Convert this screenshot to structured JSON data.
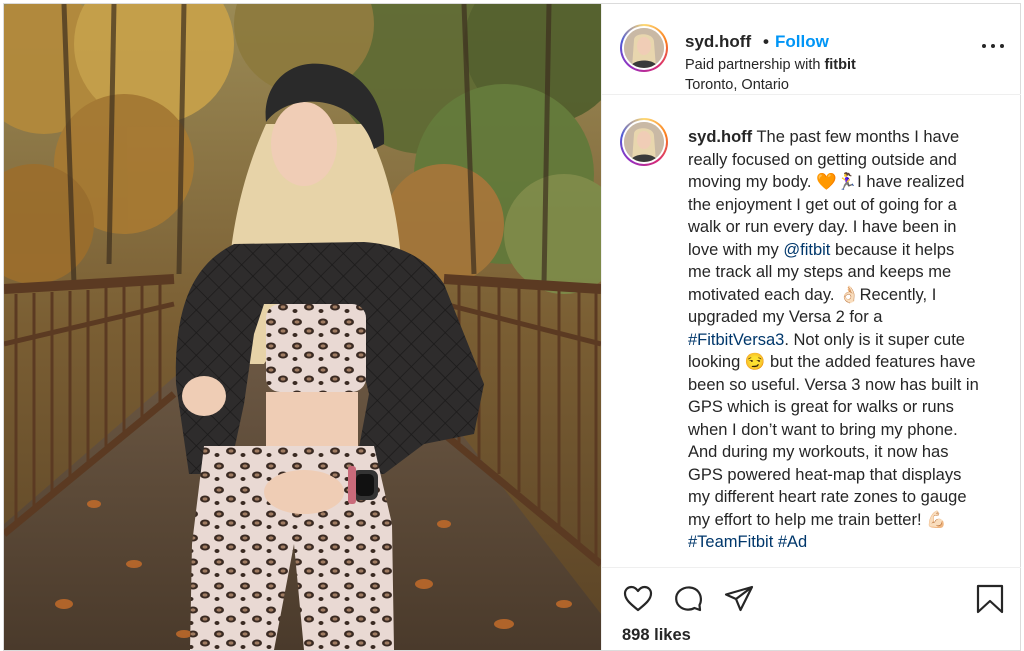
{
  "post": {
    "username": "syd.hoff",
    "separator": "•",
    "follow_label": "Follow",
    "partnership_prefix": "Paid partnership with",
    "partner_brand": "fitbit",
    "location": "Toronto, Ontario",
    "more_icon": "more-options-icon"
  },
  "caption": {
    "username": "syd.hoff",
    "text_line1": " The past few months I have",
    "lines": [
      "really focused on getting outside and",
      "moving my body. 🧡🏃‍♀️I have realized",
      "the enjoyment I get out of going for a",
      "walk or run every day. I have been in"
    ],
    "mention_prefix": "love with my ",
    "mention": "@fitbit",
    "mention_suffix": " because it helps",
    "lines2": [
      "me track all my steps and keeps me",
      "motivated each day. 👌🏻Recently, I",
      "upgraded my Versa 2 for a"
    ],
    "hashtag_versa": "#FitbitVersa3",
    "hashtag_versa_suffix": ". Not only is it super cute",
    "lines3": [
      "looking 😏 but the added features have",
      "been so useful. Versa 3 now has built in",
      "GPS which is great for walks or runs",
      "when I don’t want to bring my phone.",
      "And during my workouts, it now has",
      "GPS powered heat-map that displays",
      "my different heart rate zones to gauge",
      "my effort to help me train better! 💪🏻"
    ],
    "hashtag_team": "#TeamFitbit",
    "hashtag_ad": "#Ad"
  },
  "actions": {
    "like_icon": "heart-icon",
    "comment_icon": "comment-icon",
    "share_icon": "share-icon",
    "save_icon": "bookmark-icon",
    "likes": "898 likes"
  },
  "colors": {
    "link_blue": "#0095f6",
    "hashtag": "#00376b",
    "text": "#262626",
    "border": "#dbdbdb"
  }
}
